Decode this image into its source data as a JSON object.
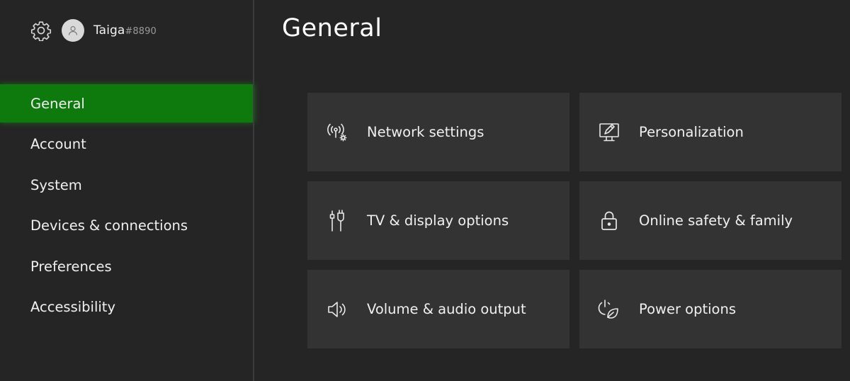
{
  "profile": {
    "gamertag": "Taiga",
    "gamertag_suffix": "#8890"
  },
  "sidebar": {
    "items": [
      {
        "label": "General",
        "selected": true
      },
      {
        "label": "Account",
        "selected": false
      },
      {
        "label": "System",
        "selected": false
      },
      {
        "label": "Devices & connections",
        "selected": false
      },
      {
        "label": "Preferences",
        "selected": false
      },
      {
        "label": "Accessibility",
        "selected": false
      }
    ]
  },
  "main": {
    "title": "General",
    "tiles": [
      {
        "label": "Network settings",
        "icon": "network-icon"
      },
      {
        "label": "Personalization",
        "icon": "personalization-icon"
      },
      {
        "label": "TV & display options",
        "icon": "display-cable-icon"
      },
      {
        "label": "Online safety & family",
        "icon": "lock-icon"
      },
      {
        "label": "Volume & audio output",
        "icon": "speaker-icon"
      },
      {
        "label": "Power options",
        "icon": "power-leaf-icon"
      }
    ]
  },
  "colors": {
    "background": "#252525",
    "tile": "#333333",
    "accent": "#0e7a0d",
    "divider": "#3c3c3c"
  }
}
